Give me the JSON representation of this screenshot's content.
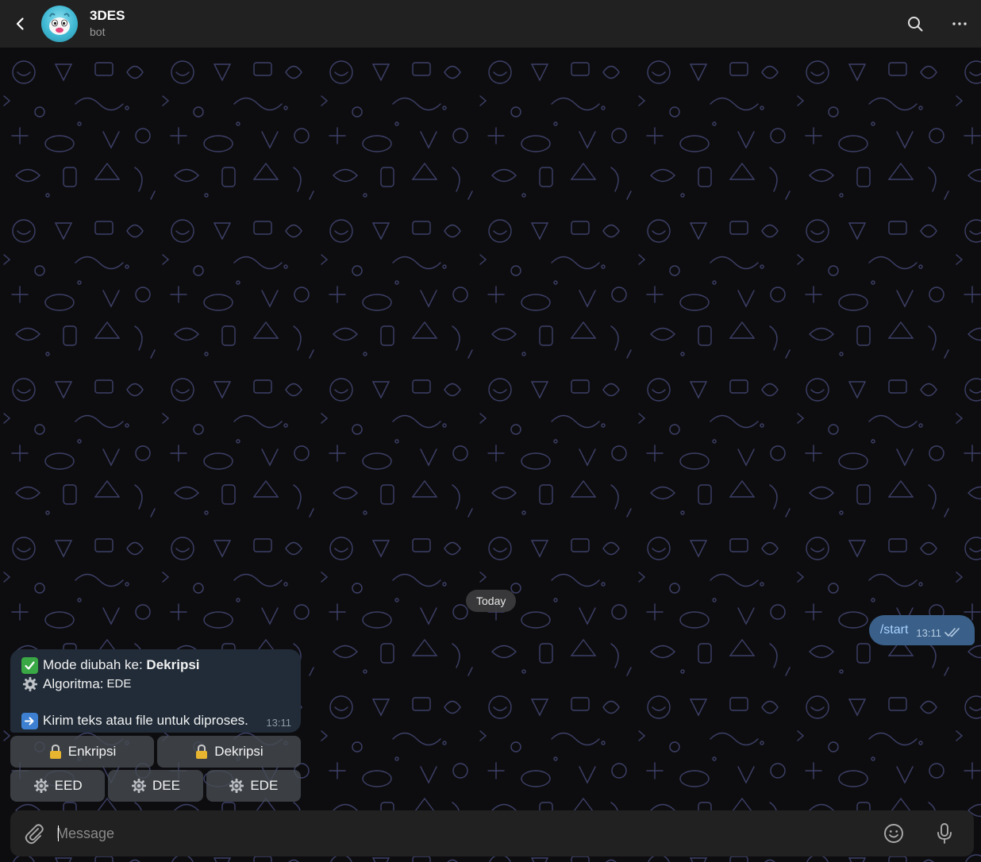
{
  "header": {
    "title": "3DES",
    "subtitle": "bot",
    "back_icon": "chevron-left-icon",
    "search_icon": "search-icon",
    "more_icon": "more-horizontal-icon"
  },
  "chat": {
    "date_separator": "Today",
    "outgoing": {
      "text": "/start",
      "time": "13:11",
      "status": "read"
    },
    "incoming": {
      "line1_prefix": "Mode diubah ke: ",
      "line1_bold": "Dekripsi",
      "line2_prefix": "Algoritma:",
      "line2_value": "EDE",
      "line3": "Kirim teks atau file untuk diproses.",
      "time": "13:11"
    },
    "keyboard": {
      "row1": [
        "Enkripsi",
        "Dekripsi"
      ],
      "row2": [
        "EED",
        "DEE",
        "EDE"
      ]
    }
  },
  "composer": {
    "placeholder": "Message",
    "attach_icon": "paperclip-icon",
    "emoji_icon": "smile-icon",
    "mic_icon": "microphone-icon"
  },
  "colors": {
    "header_bg": "#212121",
    "outgoing_bubble": "#3a6089",
    "incoming_bubble": "#212c38",
    "keyboard_button": "#45494f"
  }
}
